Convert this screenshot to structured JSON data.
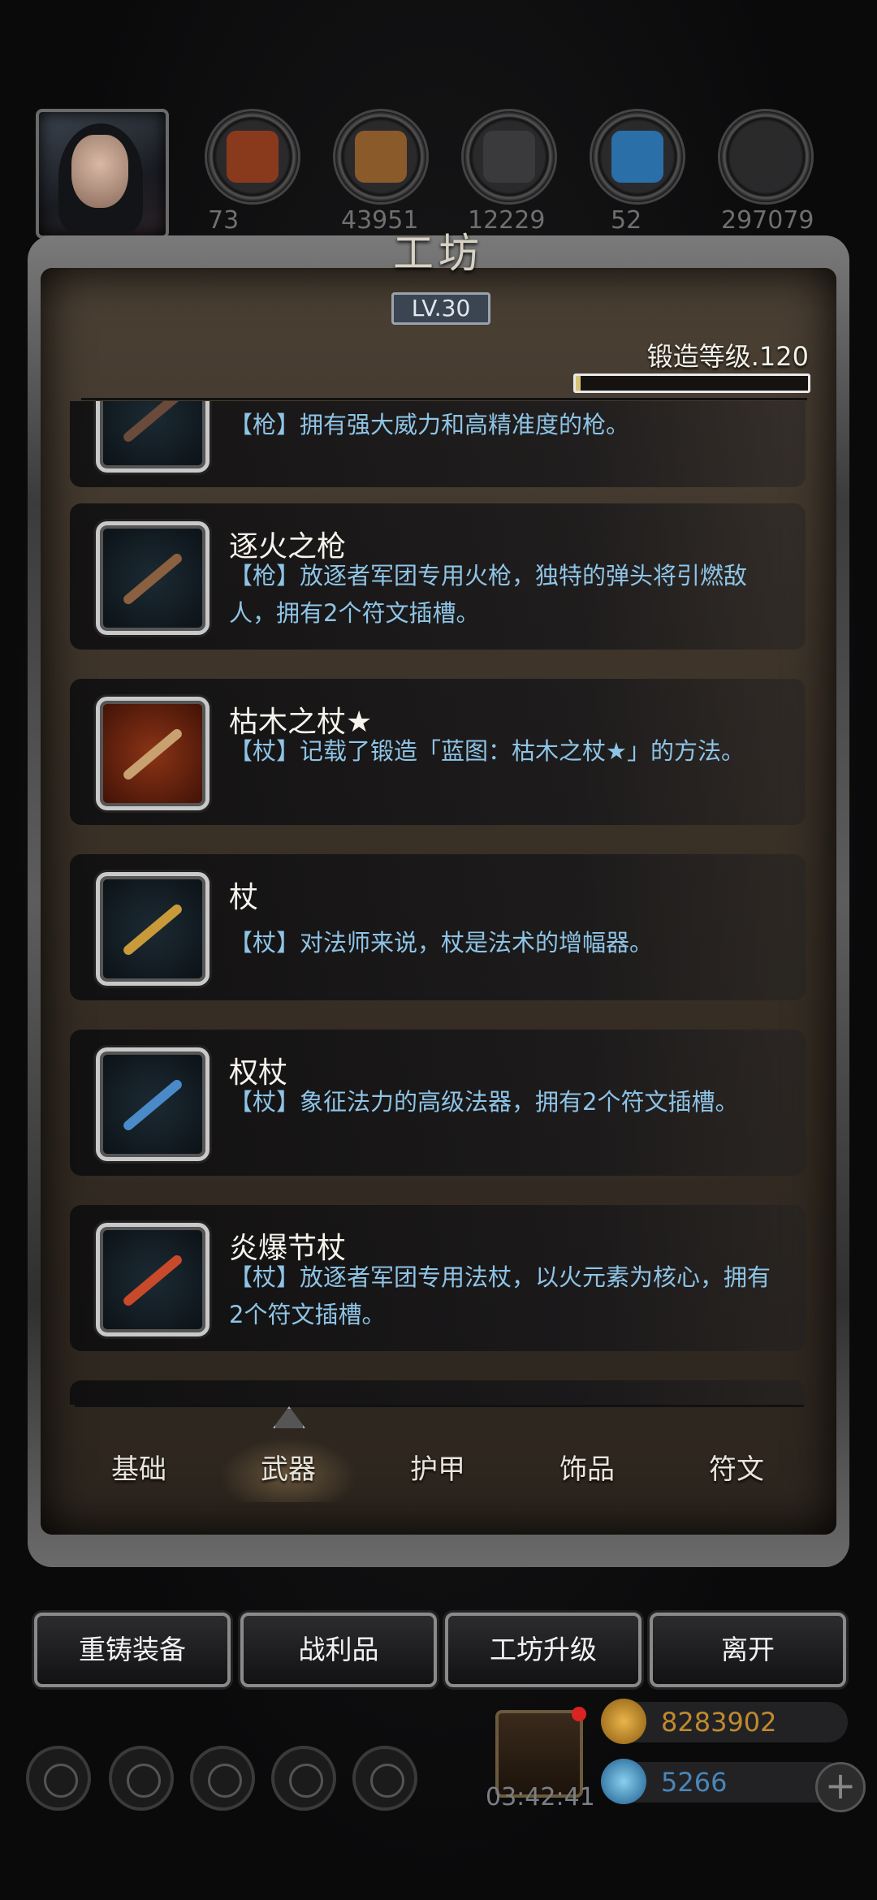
{
  "header": {
    "resources": [
      {
        "name": "meat-icon",
        "value": "73",
        "color": "#8a3a1c"
      },
      {
        "name": "wood-icon",
        "value": "43951",
        "color": "#8b5a2b"
      },
      {
        "name": "iron-icon",
        "value": "12229",
        "color": "#3a3a3c"
      },
      {
        "name": "crystal-icon",
        "value": "52",
        "color": "#2b6fa8"
      },
      {
        "name": "stone-icon",
        "value": "297079",
        "color": "#2a2a2a"
      }
    ]
  },
  "panel": {
    "title": "工坊",
    "level": "LV.30",
    "forge_label": "锻造等级.120",
    "forge_progress": 0.02
  },
  "items": [
    {
      "name": "",
      "desc": "【枪】拥有强大威力和高精准度的枪。",
      "color": "#6a4a3a"
    },
    {
      "name": "逐火之枪",
      "desc": "【枪】放逐者军团专用火枪，独特的弹头将引燃敌人，拥有2个符文插槽。",
      "color": "#8a6040"
    },
    {
      "name": "枯木之杖★",
      "desc": "【杖】记载了锻造「蓝图：枯木之杖★」的方法。",
      "color": "#c9a070"
    },
    {
      "name": "杖",
      "desc": "【杖】对法师来说，杖是法术的增幅器。",
      "color": "#c89a3a"
    },
    {
      "name": "权杖",
      "desc": "【杖】象征法力的高级法器，拥有2个符文插槽。",
      "color": "#4a8ac8"
    },
    {
      "name": "炎爆节杖",
      "desc": "【杖】放逐者军团专用法杖，以火元素为核心，拥有2个符文插槽。",
      "color": "#c84a2a"
    }
  ],
  "tabs": [
    "基础",
    "武器",
    "护甲",
    "饰品",
    "符文"
  ],
  "active_tab": "武器",
  "actions": [
    "重铸装备",
    "战利品",
    "工坊升级",
    "离开"
  ],
  "footer": {
    "timer": "03:42:41",
    "gold": "8283902",
    "gems": "5266",
    "plus": "+"
  }
}
